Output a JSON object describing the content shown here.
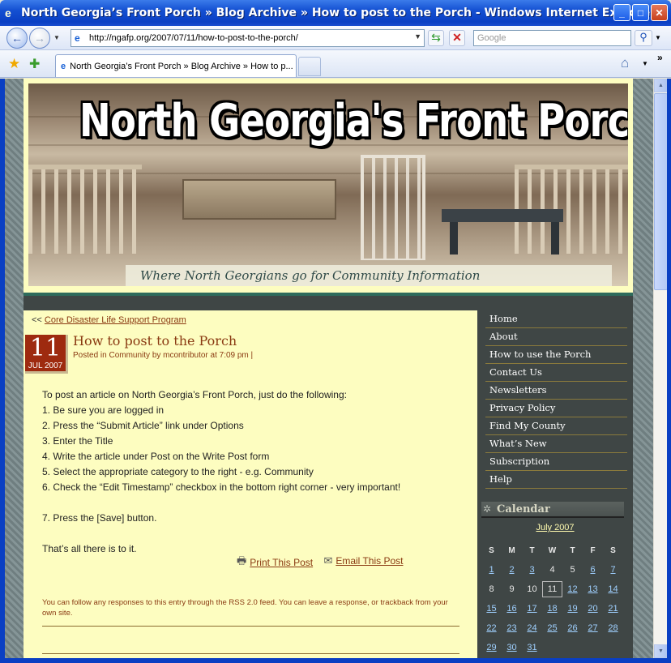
{
  "window": {
    "title": "North Georgia’s Front Porch » Blog Archive » How to post to the Porch - Windows Internet Explorer",
    "minimize": "_",
    "maximize": "□",
    "close": "✕"
  },
  "navbar": {
    "url": "http://ngafp.org/2007/07/11/how-to-post-to-the-porch/",
    "search_placeholder": "Google"
  },
  "tabs": [
    {
      "label": "North Georgia’s Front Porch » Blog Archive » How to p..."
    }
  ],
  "banner": {
    "title": "North Georgia's Front Porch",
    "tagline": "Where North Georgians go for Community Information"
  },
  "post": {
    "prev_prefix": "<<",
    "prev_link": "Core Disaster Life Support Program",
    "day": "11",
    "month": "JUL 2007",
    "title": "How to post to the Porch",
    "meta": "Posted in Community by mcontributor at 7:09 pm |",
    "body": [
      "To post an article on North Georgia’s Front Porch, just do the following:",
      "1. Be sure you are logged in",
      "2. Press the “Submit Article” link under Options",
      "3. Enter the Title",
      "4. Write the article under Post on the Write Post form",
      "5. Select the appropriate category to the right - e.g. Community",
      "6. Check the “Edit Timestamp” checkbox in the bottom right corner - very important!",
      "",
      "7. Press the [Save] button.",
      "",
      "That’s all there is to it."
    ],
    "print_label": "Print This Post",
    "email_label": "Email This Post",
    "footer": "You can follow any responses to this entry through the RSS 2.0 feed. You can leave a response, or trackback from your own site."
  },
  "sidebar": {
    "menu": [
      "Home",
      "About",
      "How to use the Porch",
      "Contact Us",
      "Newsletters",
      "Privacy Policy",
      "Find My County",
      "What’s New",
      "Subscription",
      "Help"
    ],
    "calendar_title": "Calendar",
    "calendar_month": "July 2007",
    "weekdays": [
      "S",
      "M",
      "T",
      "W",
      "T",
      "F",
      "S"
    ],
    "weeks": [
      [
        "1",
        "2",
        "3",
        "4",
        "5",
        "6",
        "7"
      ],
      [
        "8",
        "9",
        "10",
        "11",
        "12",
        "13",
        "14"
      ],
      [
        "15",
        "16",
        "17",
        "18",
        "19",
        "20",
        "21"
      ],
      [
        "22",
        "23",
        "24",
        "25",
        "26",
        "27",
        "28"
      ],
      [
        "29",
        "30",
        "31",
        "",
        "",
        "",
        ""
      ]
    ],
    "linked_days": [
      "1",
      "2",
      "3",
      "6",
      "7",
      "12",
      "13",
      "14",
      "15",
      "16",
      "17",
      "18",
      "19",
      "20",
      "21",
      "22",
      "23",
      "24",
      "25",
      "26",
      "27",
      "28",
      "29",
      "30",
      "31"
    ],
    "today": "11"
  }
}
